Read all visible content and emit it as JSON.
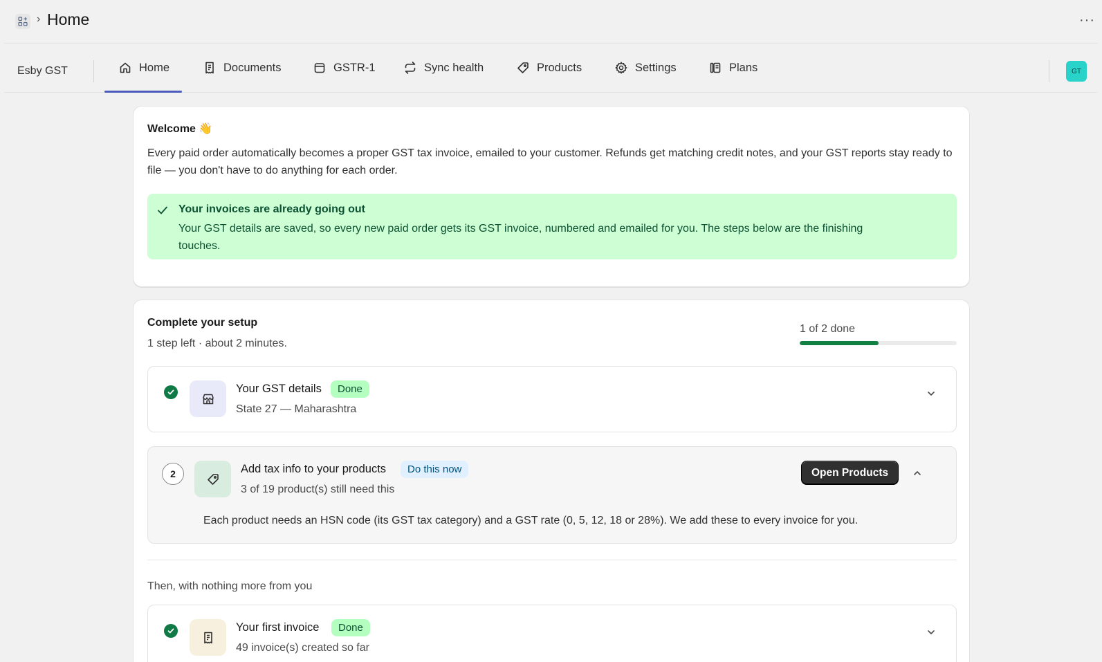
{
  "header": {
    "title": "Home",
    "breadcrumb_separator": "›",
    "more_label": "···"
  },
  "nav": {
    "app_name": "Esby GST",
    "tabs": [
      {
        "label": "Home",
        "icon": "home-icon",
        "active": true
      },
      {
        "label": "Documents",
        "icon": "receipt-icon",
        "active": false
      },
      {
        "label": "GSTR-1",
        "icon": "calendar-icon",
        "active": false
      },
      {
        "label": "Sync health",
        "icon": "refresh-icon",
        "active": false
      },
      {
        "label": "Products",
        "icon": "tag-icon",
        "active": false
      },
      {
        "label": "Settings",
        "icon": "gear-icon",
        "active": false
      },
      {
        "label": "Plans",
        "icon": "plans-icon",
        "active": false
      }
    ],
    "avatar_initials": "GT",
    "accent_color": "#4b5bbd"
  },
  "welcome": {
    "title": "Welcome 👋",
    "body": "Every paid order automatically becomes a proper GST tax invoice, emailed to your customer. Refunds get matching credit notes, and your GST reports stay ready to file — you don't have to do anything for each order.",
    "banner": {
      "title": "Your invoices are already going out",
      "body": "Your GST details are saved, so every new paid order gets its GST invoice, numbered and emailed for you. The steps below are the finishing touches."
    }
  },
  "setup": {
    "title": "Complete your setup",
    "subtitle": "1 step left · about 2 minutes.",
    "progress_label": "1 of 2 done",
    "progress_fraction": 0.5,
    "steps": [
      {
        "title": "Your GST details",
        "badge": "Done",
        "subtitle": "State 27 — Maharashtra",
        "icon": "store-icon",
        "status": "done"
      },
      {
        "number": "2",
        "title": "Add tax info to your products",
        "badge": "Do this now",
        "subtitle": "3 of 19 product(s) still need this",
        "icon": "tag-icon",
        "button": "Open Products",
        "description": "Each product needs an HSN code (its GST tax category) and a GST rate (0, 5, 12, 18 or 28%). We add these to every invoice for you.",
        "status": "active"
      }
    ],
    "then_label": "Then, with nothing more from you",
    "auto_steps": [
      {
        "title": "Your first invoice",
        "badge": "Done",
        "subtitle": "49 invoice(s) created so far",
        "icon": "receipt-icon",
        "status": "done"
      }
    ]
  }
}
